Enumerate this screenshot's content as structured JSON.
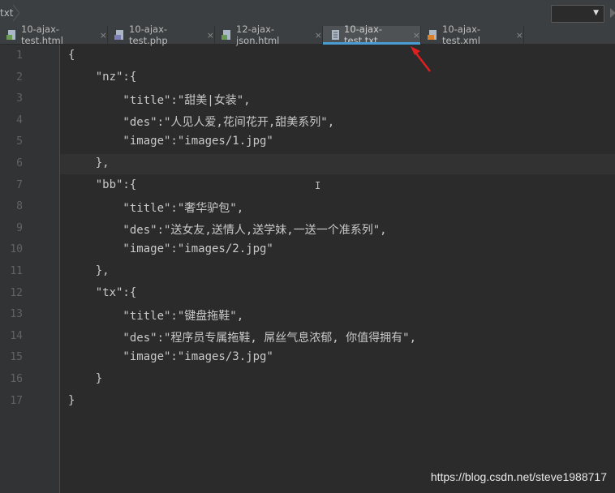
{
  "topbar": {
    "crumb": "txt"
  },
  "tabs": [
    {
      "label": "10-ajax-test.html",
      "icon": "html-file-icon",
      "active": false
    },
    {
      "label": "10-ajax-test.php",
      "icon": "php-file-icon",
      "active": false
    },
    {
      "label": "12-ajax-json.html",
      "icon": "html-file-icon",
      "active": false
    },
    {
      "label": "10-ajax-test.txt",
      "icon": "text-file-icon",
      "active": true
    },
    {
      "label": "10-ajax-test.xml",
      "icon": "xml-file-icon",
      "active": false
    }
  ],
  "tab_close": "×",
  "line_numbers": [
    "1",
    "2",
    "3",
    "4",
    "5",
    "6",
    "7",
    "8",
    "9",
    "10",
    "11",
    "12",
    "13",
    "14",
    "15",
    "16",
    "17"
  ],
  "code": [
    "{",
    "    \"nz\":{",
    "        \"title\":\"甜美|女装\",",
    "        \"des\":\"人见人爱,花间花开,甜美系列\",",
    "        \"image\":\"images/1.jpg\"",
    "    },",
    "    \"bb\":{",
    "        \"title\":\"奢华驴包\",",
    "        \"des\":\"送女友,送情人,送学妹,一送一个准系列\",",
    "        \"image\":\"images/2.jpg\"",
    "    },",
    "    \"tx\":{",
    "        \"title\":\"键盘拖鞋\",",
    "        \"des\":\"程序员专属拖鞋, 屌丝气息浓郁, 你值得拥有\",",
    "        \"image\":\"images/3.jpg\"",
    "    }",
    "}"
  ],
  "text_cursor": "I",
  "watermark": "https://blog.csdn.net/steve1988717",
  "colors": {
    "active_tab_underline": "#4a9dd2",
    "arrow": "#e02020"
  }
}
